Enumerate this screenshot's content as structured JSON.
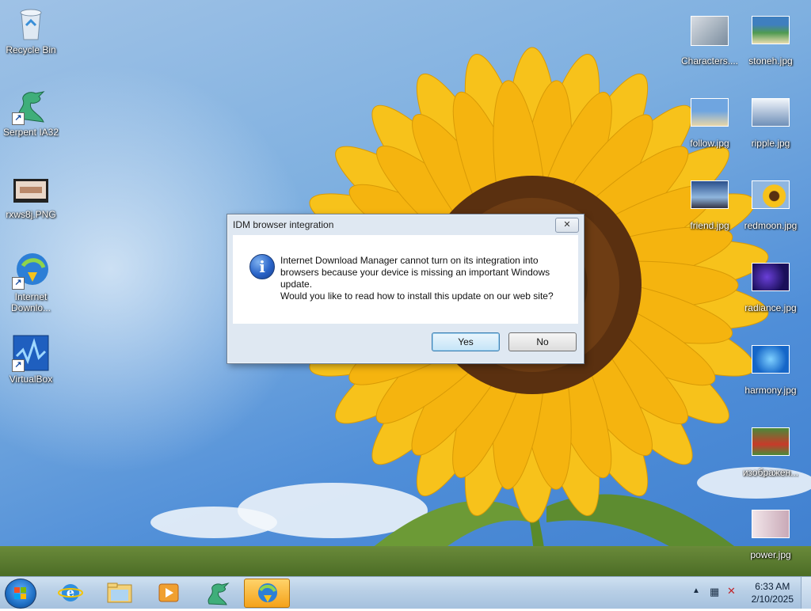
{
  "desktop_left": [
    {
      "label": "Recycle Bin",
      "icon": "recycle-bin-icon"
    },
    {
      "label": "Serpent IA32",
      "icon": "serpent-icon"
    },
    {
      "label": "rxws8j.PNG",
      "icon": "image-file-icon"
    },
    {
      "label": "Internet Downlo...",
      "icon": "idm-icon"
    },
    {
      "label": "VirtualBox",
      "icon": "virtualbox-icon"
    }
  ],
  "desktop_right": [
    {
      "label": "Characters....",
      "icon": "image-file-icon"
    },
    {
      "label": "stoneh.jpg",
      "icon": "image-file-icon"
    },
    {
      "label": "follow.jpg",
      "icon": "image-file-icon"
    },
    {
      "label": "ripple.jpg",
      "icon": "image-file-icon"
    },
    {
      "label": "friend.jpg",
      "icon": "image-file-icon"
    },
    {
      "label": "redmoon.jpg",
      "icon": "image-file-icon"
    },
    {
      "label": "radiance.jpg",
      "icon": "image-file-icon"
    },
    {
      "label": "harmony.jpg",
      "icon": "image-file-icon"
    },
    {
      "label": "изображен...",
      "icon": "image-file-icon"
    },
    {
      "label": "power.jpg",
      "icon": "image-file-icon"
    }
  ],
  "dialog": {
    "title": "IDM browser integration",
    "close": "✕",
    "message_lines": [
      "Internet Download Manager cannot turn on its integration into",
      "browsers because your device is missing an important Windows",
      "update.",
      "Would you like to read how to install this update on our web site?"
    ],
    "yes": "Yes",
    "no": "No"
  },
  "taskbar": {
    "items": [
      "start-button",
      "internet-explorer-icon",
      "file-explorer-icon",
      "media-player-icon",
      "serpent-icon",
      "idm-icon"
    ],
    "active_item": "idm-icon",
    "time": "6:33 AM",
    "date": "2/10/2025"
  },
  "colors": {
    "sky": "#7fb0e0",
    "petal": "#f7c21b",
    "center": "#6b3a12",
    "accent": "#f4a21a"
  }
}
